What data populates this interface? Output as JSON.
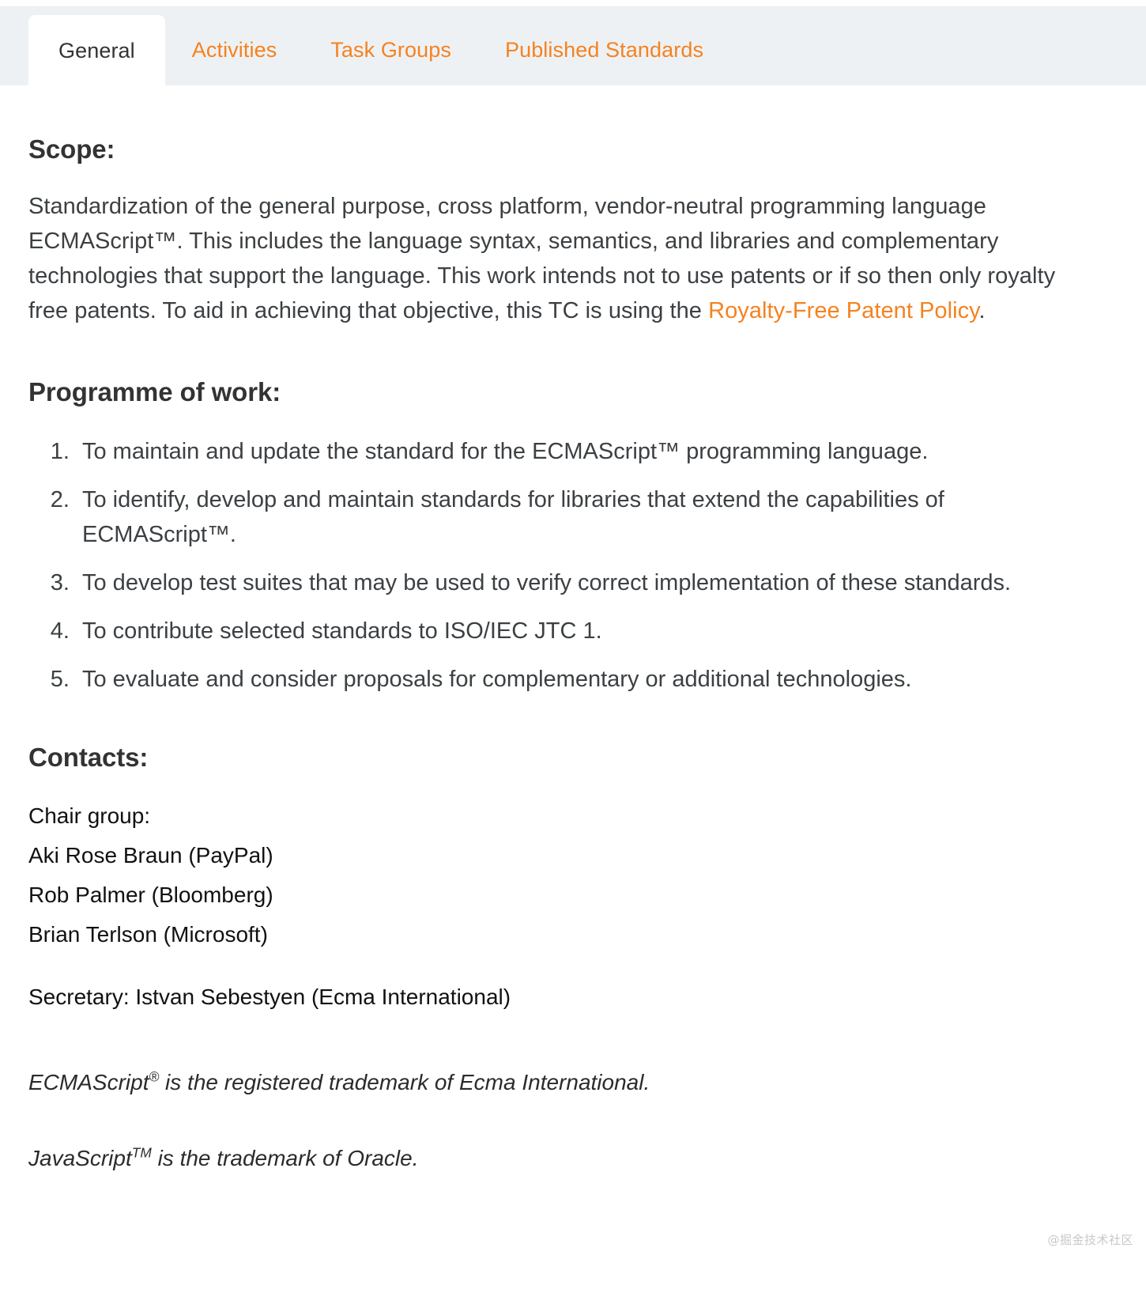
{
  "colors": {
    "accent": "#f58220",
    "tabbar_bg": "#eef1f4",
    "active_tab_bg": "#ffffff",
    "body_text": "#3c4043",
    "heading_text": "#333333",
    "watermark": "#c8c8c8"
  },
  "tabs": [
    {
      "label": "General",
      "active": true
    },
    {
      "label": "Activities",
      "active": false
    },
    {
      "label": "Task Groups",
      "active": false
    },
    {
      "label": "Published Standards",
      "active": false
    }
  ],
  "scope": {
    "heading": "Scope:",
    "text_before_link": "Standardization of the general purpose, cross platform, vendor-neutral programming language ECMAScript™. This includes the language syntax, semantics, and libraries and complementary technologies that support the language. This work intends not to use patents or if so then only royalty free patents. To aid in achieving that objective, this TC is using the ",
    "link_text": "Royalty-Free Patent Policy",
    "text_after_link": "."
  },
  "programme": {
    "heading": "Programme of work:",
    "items": [
      "To maintain and update the standard for the ECMAScript™ programming language.",
      "To identify, develop and maintain standards for libraries that extend the capabilities of ECMAScript™.",
      "To develop test suites that may be used to verify correct implementation of these standards.",
      "To contribute selected standards to ISO/IEC JTC 1.",
      "To evaluate and consider proposals for complementary or additional technologies."
    ]
  },
  "contacts": {
    "heading": "Contacts:",
    "chair_group_label": "Chair group:",
    "chairs": [
      "Aki Rose Braun (PayPal)",
      "Rob Palmer (Bloomberg)",
      "Brian Terlson (Microsoft)"
    ],
    "secretary": "Secretary: Istvan Sebestyen (Ecma International)"
  },
  "trademarks": {
    "ecmascript": {
      "name": "ECMAScript",
      "mark": "®",
      "rest": " is the registered trademark of Ecma International."
    },
    "javascript": {
      "name": "JavaScript",
      "mark": "TM",
      "rest": " is the trademark of Oracle."
    }
  },
  "watermark": "@掘金技术社区"
}
